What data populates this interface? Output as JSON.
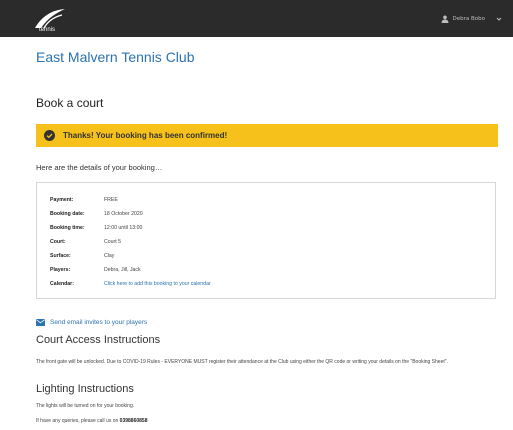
{
  "header": {
    "user_name": "Debra Bobo"
  },
  "club_name": "East Malvern Tennis Club",
  "page_title": "Book a court",
  "alert": {
    "message": "Thanks! Your booking has been confirmed!",
    "color": "#f5c11a"
  },
  "intro": "Here are the details of your booking…",
  "details": [
    {
      "label": "Payment:",
      "value": "FREE"
    },
    {
      "label": "Booking date:",
      "value": "18 October 2020"
    },
    {
      "label": "Booking time:",
      "value": "12:00 until 13:00"
    },
    {
      "label": "Court:",
      "value": "Court 5"
    },
    {
      "label": "Surface:",
      "value": "Clay"
    },
    {
      "label": "Players:",
      "value": "Debra, Jill, Jack"
    },
    {
      "label": "Calendar:",
      "value": "Click here to add this booking to your calendar"
    }
  ],
  "invite_link": "Send email invites to your players",
  "court_access": {
    "heading": "Court Access Instructions",
    "text": "The front gate will be unlocked. Due to COVID-19 Rules - EVERYONE MUST register their attendance at the Club using either the QR code or writing your details on the \"Booking Sheet\"."
  },
  "lighting": {
    "heading": "Lighting Instructions",
    "text": "The lights will be turned on for your booking.",
    "queries_prefix": "If have any queries, please call us on",
    "phone": "0398860858"
  },
  "colors": {
    "topbar": "#2b2b2b",
    "link": "#2b73b0",
    "alert": "#f5c11a"
  }
}
